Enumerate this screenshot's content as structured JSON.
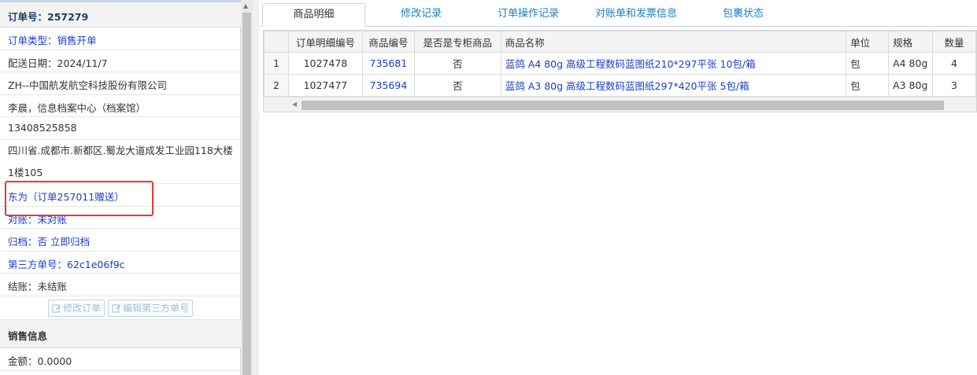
{
  "order": {
    "header": "订单号：257279",
    "rows": [
      {
        "text": "订单类型：销售开单",
        "blue": true
      },
      {
        "text": "配送日期：2024/11/7",
        "blue": false
      },
      {
        "text": "ZH--中国航发航空科技股份有限公司",
        "blue": false
      },
      {
        "text": "李晨，信息档案中心（档案馆）",
        "blue": false
      },
      {
        "text": "13408525858",
        "blue": false
      },
      {
        "text": "四川省.成都市.新都区.蜀龙大道成发工业园118大楼1楼105",
        "blue": false,
        "multi": true
      },
      {
        "text": "东为（订单257011赠送）",
        "blue": true
      },
      {
        "text": "对账：未对账",
        "blue": true
      },
      {
        "text": "归档：否 立即归档",
        "blue": true
      },
      {
        "text": "第三方单号：62c1e06f9c",
        "blue": true
      },
      {
        "text": "结账：未结账",
        "blue": false
      }
    ],
    "edit_order_label": "修改订单",
    "edit_third_party_label": "编辑第三方单号"
  },
  "sales": {
    "header": "销售信息",
    "amount": "金额：0.0000"
  },
  "tabs": [
    "商品明细",
    "修改记录",
    "订单操作记录",
    "对账单和发票信息",
    "包裹状态"
  ],
  "table": {
    "columns": [
      "",
      "订单明细编号",
      "商品编号",
      "是否是专柜商品",
      "商品名称",
      "单位",
      "规格",
      "数量"
    ],
    "rows": [
      [
        "1",
        "1027478",
        "735681",
        "否",
        "蓝鸽 A4 80g 高级工程数码蓝图纸210*297平张 10包/箱",
        "包",
        "A4 80g",
        "4"
      ],
      [
        "2",
        "1027477",
        "735694",
        "否",
        "蓝鸽 A3 80g 高级工程数码蓝图纸297*420平张 5包/箱",
        "包",
        "A3 80g",
        "3"
      ]
    ]
  },
  "colors": {
    "link": "#1a3ccf",
    "tab": "#1a7fc6",
    "highlight": "#e53935"
  }
}
